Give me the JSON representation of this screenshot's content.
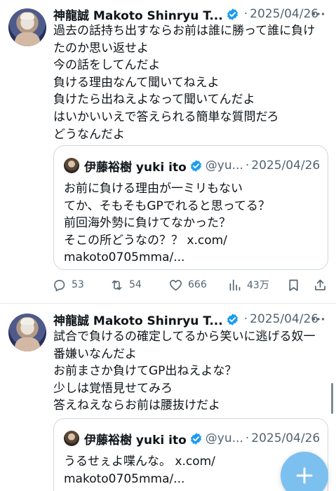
{
  "tweets": [
    {
      "author_name": "神龍誠 Makoto Shinryu T...",
      "separator": "·",
      "date": "2025/04/26",
      "text_lines": [
        "過去の話持ち出すならお前は誰に勝って誰に負け",
        "たのか思い返せよ",
        "今の話をしてんだよ",
        "負ける理由なんて聞いてねえよ",
        "負けたら出ねえよなって聞いてんだよ",
        "はいかいいえで答えられる簡単な質問だろ",
        "どうなんだよ"
      ],
      "quote": {
        "author_name": "伊藤裕樹 yuki ito",
        "handle": "@yu...",
        "separator": "·",
        "date": "2025/04/26",
        "text_lines": [
          "お前に負ける理由が一ミリもない",
          "てか、そもそもGPでれると思ってる？",
          "前回海外勢に負けてなかった？",
          "そこの所どうなの？？ x.com/",
          "makoto0705mma/..."
        ]
      },
      "stats": {
        "replies": "53",
        "retweets": "54",
        "likes": "666",
        "views": "43万"
      }
    },
    {
      "author_name": "神龍誠 Makoto Shinryu T...",
      "separator": "·",
      "date": "2025/04/26",
      "text_lines": [
        "試合で負けるの確定してるから笑いに逃げる奴一",
        "番嫌いなんだよ",
        "お前まさか負けてGP出ねえよな？",
        "少しは覚悟見せてみろ",
        "答えねえならお前は腰抜けだよ"
      ],
      "quote": {
        "author_name": "伊藤裕樹 yuki ito",
        "handle": "@yu...",
        "separator": "·",
        "date": "2025/04/26",
        "text_lines": [
          "うるせぇよ喋んな。 x.com/",
          "makoto0705mma/..."
        ]
      }
    }
  ],
  "icons": {
    "verified": "verified-badge-icon",
    "more": "more-dots-icon",
    "reply": "reply-icon",
    "retweet": "retweet-icon",
    "like": "heart-icon",
    "views": "views-chart-icon",
    "bookmark": "bookmark-icon",
    "share": "share-icon",
    "compose": "plus-icon"
  },
  "colors": {
    "verified": "#1d9bf0",
    "text": "#0f1419",
    "muted": "#536471",
    "fab": "#7cc0f0"
  }
}
